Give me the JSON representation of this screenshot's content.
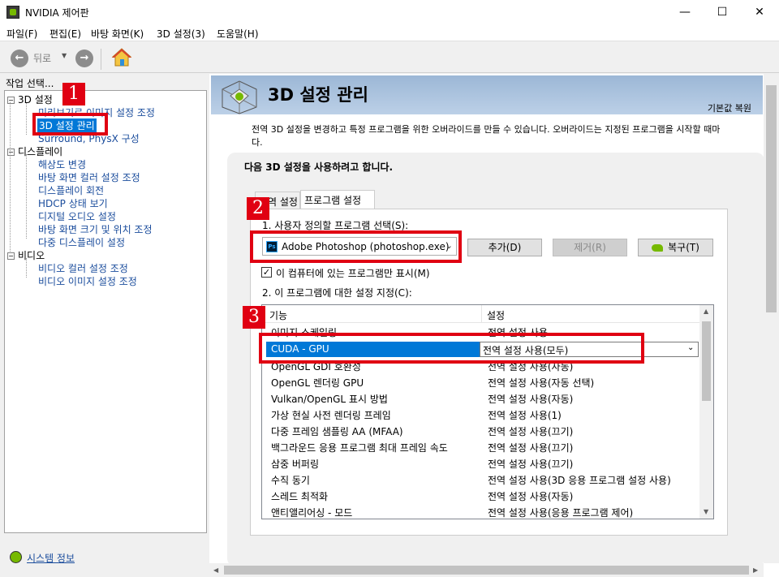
{
  "window": {
    "title": "NVIDIA 제어판",
    "controls": {
      "minimize": "—",
      "maximize": "☐",
      "close": "✕"
    }
  },
  "menu": {
    "items": [
      "파일(F)",
      "편집(E)",
      "바탕 화면(K)",
      "3D 설정(3)",
      "도움말(H)"
    ]
  },
  "toolbar": {
    "back_label": "뒤로",
    "back_icon": "back-arrow-icon",
    "forward_icon": "forward-arrow-icon",
    "home_icon": "home-icon"
  },
  "sidebar": {
    "task_label": "작업 선택...",
    "categories": [
      {
        "label": "3D 설정",
        "items": [
          "미리보기로 이미지 설정 조정",
          "3D 설정 관리",
          "Surround, PhysX 구성"
        ]
      },
      {
        "label": "디스플레이",
        "items": [
          "해상도 변경",
          "바탕 화면 컬러 설정 조정",
          "디스플레이 회전",
          "HDCP 상태 보기",
          "디지털 오디오 설정",
          "바탕 화면 크기 및 위치 조정",
          "다중 디스플레이 설정"
        ]
      },
      {
        "label": "비디오",
        "items": [
          "비디오 컬러 설정 조정",
          "비디오 이미지 설정 조정"
        ]
      }
    ],
    "selected_item": "3D 설정 관리",
    "system_info_link": "시스템 정보"
  },
  "main": {
    "page_title": "3D 설정 관리",
    "restore_defaults": "기본값 복원",
    "description": "전역 3D 설정을 변경하고 특정 프로그램을 위한 오버라이드를 만들 수 있습니다. 오버라이드는 지정된 프로그램을 시작할 때마",
    "description_cont": "다.",
    "section_heading": "다음 3D 설정을 사용하려고 합니다.",
    "tabs": [
      {
        "label": "전역 설정",
        "active": false
      },
      {
        "label": "프로그램 설정",
        "active": true
      }
    ],
    "step1_label": "1. 사용자 정의할 프로그램 선택(S):",
    "program_select": {
      "value": "Adobe Photoshop (photoshop.exe)",
      "icon": "photoshop-icon"
    },
    "buttons": {
      "add": "추가(D)",
      "remove": "제거(R)",
      "restore": "복구(T)"
    },
    "only_show_checkbox": {
      "label": "이 컴퓨터에 있는 프로그램만 표시(M)",
      "checked": true
    },
    "step2_label": "2. 이 프로그램에 대한 설정 지정(C):",
    "settings_table": {
      "headers": [
        "기능",
        "설정"
      ],
      "rows": [
        [
          "이미지 스케일링",
          "전역 설정 사용"
        ],
        [
          "CUDA - GPU",
          "전역 설정 사용(모두)"
        ],
        [
          "OpenGL GDI 호환성",
          "전역 설정 사용(자동)"
        ],
        [
          "OpenGL 렌더링 GPU",
          "전역 설정 사용(자동 선택)"
        ],
        [
          "Vulkan/OpenGL 표시 방법",
          "전역 설정 사용(자동)"
        ],
        [
          "가상 현실 사전 렌더링 프레임",
          "전역 설정 사용(1)"
        ],
        [
          "다중 프레임 샘플링 AA (MFAA)",
          "전역 설정 사용(끄기)"
        ],
        [
          "백그라운드 응용 프로그램 최대 프레임 속도",
          "전역 설정 사용(끄기)"
        ],
        [
          "삼중 버퍼링",
          "전역 설정 사용(끄기)"
        ],
        [
          "수직 동기",
          "전역 설정 사용(3D 응용 프로그램 설정 사용)"
        ],
        [
          "스레드 최적화",
          "전역 설정 사용(자동)"
        ],
        [
          "앤티앨리어싱 - 모드",
          "전역 설정 사용(응용 프로그램 제어)"
        ]
      ],
      "selected_row": 1
    }
  },
  "annotations": [
    {
      "number": "1",
      "color": "#e00012"
    },
    {
      "number": "2",
      "color": "#e00012"
    },
    {
      "number": "3",
      "color": "#e00012"
    }
  ],
  "colors": {
    "accent": "#0078d7",
    "link": "#1a4c9c",
    "nvidia_green": "#76b900",
    "annotation_red": "#e00012",
    "header_blue": "#9cb7d6"
  }
}
